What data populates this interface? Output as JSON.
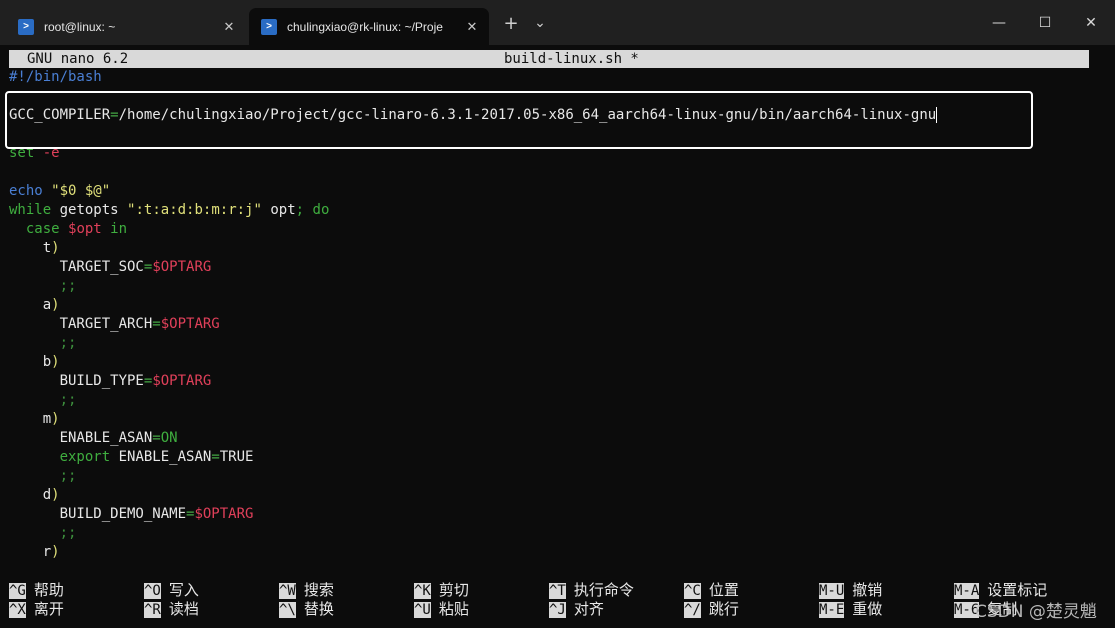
{
  "window": {
    "tabs": [
      {
        "label": "root@linux: ~",
        "active": false
      },
      {
        "label": "chulingxiao@rk-linux: ~/Proje",
        "active": true
      }
    ],
    "new_tab_glyph": "+",
    "dropdown_glyph": "⌄",
    "minimize_glyph": "—",
    "maximize_glyph": "☐",
    "close_glyph": "✕",
    "tab_close_glyph": "✕"
  },
  "nano": {
    "version": "GNU nano 6.2",
    "filename": "build-linux.sh *"
  },
  "code": {
    "shebang": "#!/bin/bash",
    "gcc_name": "GCC_COMPILER",
    "gcc_eq": "=",
    "gcc_value": "/home/chulingxiao/Project/gcc-linaro-6.3.1-2017.05-x86_64_aarch64-linux-gnu/bin/aarch64-linux-gnu",
    "set_kw": "set",
    "set_arg": "-e",
    "echo_kw": "echo",
    "echo_arg": "\"$0 $@\"",
    "while_kw": "while",
    "getopts": "getopts",
    "getopts_str": "\":t:a:d:b:m:r:j\"",
    "opt_word": "opt",
    "semi": ";",
    "do_kw": "do",
    "case_kw": "case",
    "case_var": "$opt",
    "in_kw": "in",
    "t_case": "t",
    "paren": ")",
    "target_soc": "TARGET_SOC",
    "optarg": "$OPTARG",
    "dsemi": ";;",
    "a_case": "a",
    "target_arch": "TARGET_ARCH",
    "b_case": "b",
    "build_type": "BUILD_TYPE",
    "m_case": "m",
    "enable_asan": "ENABLE_ASAN",
    "on_val": "ON",
    "export_kw": "export",
    "true_val": "TRUE",
    "d_case": "d",
    "build_demo_name": "BUILD_DEMO_NAME",
    "r_case": "r",
    "eq": "="
  },
  "shortcuts": [
    {
      "key": "^G",
      "label": "帮助"
    },
    {
      "key": "^O",
      "label": "写入"
    },
    {
      "key": "^W",
      "label": "搜索"
    },
    {
      "key": "^K",
      "label": "剪切"
    },
    {
      "key": "^T",
      "label": "执行命令"
    },
    {
      "key": "^C",
      "label": "位置"
    },
    {
      "key": "M-U",
      "label": "撤销"
    },
    {
      "key": "M-A",
      "label": "设置标记"
    },
    {
      "key": "^X",
      "label": "离开"
    },
    {
      "key": "^R",
      "label": "读档"
    },
    {
      "key": "^\\",
      "label": "替换"
    },
    {
      "key": "^U",
      "label": "粘贴"
    },
    {
      "key": "^J",
      "label": "对齐"
    },
    {
      "key": "^/",
      "label": "跳行"
    },
    {
      "key": "M-E",
      "label": "重做"
    },
    {
      "key": "M-6",
      "label": "复制"
    }
  ],
  "watermark": "CSDN @楚灵魈",
  "colors": {
    "accent_blue": "#2a6cc4",
    "keyword_green": "#3fae3f",
    "variable_red": "#e0405a",
    "string_yellow": "#e0e07a"
  }
}
